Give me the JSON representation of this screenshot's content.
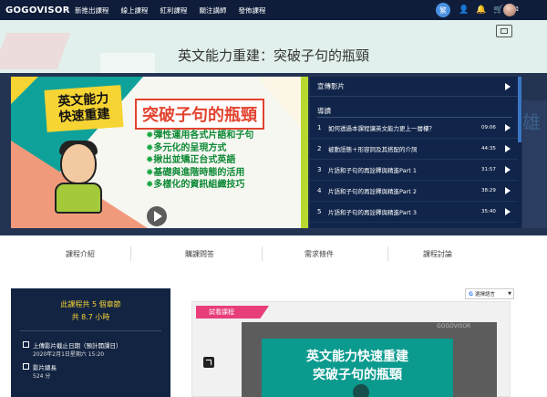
{
  "nav": {
    "logo": "GOGOVISOR",
    "links": [
      "新推出課程",
      "線上課程",
      "紅利課程",
      "關注講師",
      "發佈課程"
    ],
    "lang_badge": "繁"
  },
  "page": {
    "title": "英文能力重建：突破子句的瓶頸"
  },
  "video": {
    "badge_line1": "英文能力",
    "badge_line2": "快速重建",
    "headline": "突破子句的瓶頸",
    "bullets": [
      "彈性運用各式片語和子句",
      "多元化的呈現方式",
      "揪出並矯正台式英語",
      "基礎與進階時態的活用",
      "多樣化的資訊組織技巧"
    ]
  },
  "sidebar": {
    "promo_label": "宣傳影片",
    "guide_label": "導讀",
    "chapters": [
      {
        "num": "1",
        "title": "如何透過本課程讓英文能力更上一層樓？",
        "duration": "09:06"
      },
      {
        "num": "2",
        "title": "被動語態＋形容詞及其搭配的介詞",
        "duration": "44:35"
      },
      {
        "num": "3",
        "title": "片語和子句的再詮釋與精進Part 1",
        "duration": "31:57"
      },
      {
        "num": "4",
        "title": "片語和子句的再詮釋與精進Part 2",
        "duration": "38:29"
      },
      {
        "num": "5",
        "title": "片語和子句的再詮釋與精進Part 3",
        "duration": "35:40"
      }
    ]
  },
  "tabs": [
    "課程介紹",
    "購課問答",
    "需求條件",
    "課程討論"
  ],
  "course": {
    "chapter_count": "此課程共 5 個章節",
    "total_hours": "共 8.7 小時",
    "upload_label": "上傳影片截止日期（預計開課日）",
    "upload_value": "2020年2月1日星期六 15:20",
    "length_label": "影片總長",
    "length_value": "524 分"
  },
  "language_select": {
    "g_mark": "G",
    "text": "選擇語言",
    "caret": "▼"
  },
  "preview": {
    "tag": "試看課程",
    "thumb_logo": "GOGOVISOR",
    "line1": "英文能力快速重建",
    "line2": "突破子句的瓶頸"
  },
  "colors": {
    "nav_bg": "#0f1d3a",
    "panel_bg": "#11254a",
    "accent_yellow": "#f6d433",
    "accent_pink": "#e83d7b",
    "teal": "#0fa29a"
  }
}
